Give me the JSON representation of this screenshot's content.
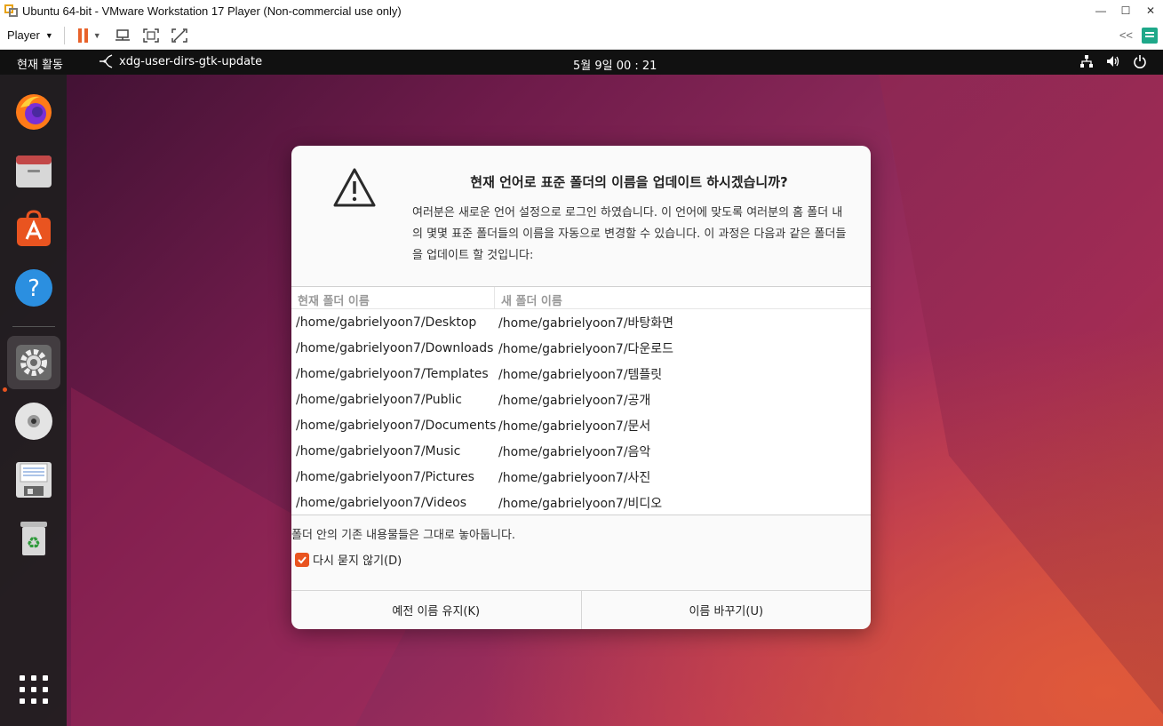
{
  "window": {
    "title": "Ubuntu 64-bit - VMware Workstation 17 Player (Non-commercial use only)",
    "controls": [
      "—",
      "☐",
      "✕"
    ]
  },
  "toolbar": {
    "player_label": "Player",
    "icons": [
      "pause-icon",
      "send-ctrl-alt-del-icon",
      "fullscreen-icon",
      "unity-icon"
    ],
    "collapse": "<<"
  },
  "topbar": {
    "activities": "현재 활동",
    "app_name": "xdg-user-dirs-gtk-update",
    "clock": "5월 9일  00 : 21"
  },
  "dock": {
    "items": [
      "firefox-icon",
      "files-icon",
      "app-center-icon",
      "help-icon",
      "settings-icon",
      "disc-icon",
      "floppy-icon",
      "trash-icon"
    ],
    "active": "settings-icon"
  },
  "dialog": {
    "heading": "현재 언어로 표준 폴더의 이름을 업데이트 하시겠습니까?",
    "description": "여러분은 새로운 언어 설정으로 로그인 하였습니다. 이 언어에 맞도록 여러분의 홈 폴더 내의 몇몇 표준 폴더들의 이름을 자동으로 변경할 수 있습니다. 이 과정은 다음과 같은 폴더들을 업데이트 할 것입니다:",
    "columns": [
      "현재 폴더 이름",
      "새 폴더 이름"
    ],
    "rows": [
      [
        "/home/gabrielyoon7/Desktop",
        "/home/gabrielyoon7/바탕화면"
      ],
      [
        "/home/gabrielyoon7/Downloads",
        "/home/gabrielyoon7/다운로드"
      ],
      [
        "/home/gabrielyoon7/Templates",
        "/home/gabrielyoon7/템플릿"
      ],
      [
        "/home/gabrielyoon7/Public",
        "/home/gabrielyoon7/공개"
      ],
      [
        "/home/gabrielyoon7/Documents",
        "/home/gabrielyoon7/문서"
      ],
      [
        "/home/gabrielyoon7/Music",
        "/home/gabrielyoon7/음악"
      ],
      [
        "/home/gabrielyoon7/Pictures",
        "/home/gabrielyoon7/사진"
      ],
      [
        "/home/gabrielyoon7/Videos",
        "/home/gabrielyoon7/비디오"
      ]
    ],
    "note": "폴더 안의 기존 내용물들은 그대로 놓아둡니다.",
    "checkbox_label": "다시 묻지 않기(D)",
    "checkbox_checked": true,
    "keep_button": "예전 이름 유지(K)",
    "rename_button": "이름 바꾸기(U)"
  },
  "colors": {
    "accent": "#e95420",
    "pause": "#e8622a"
  }
}
